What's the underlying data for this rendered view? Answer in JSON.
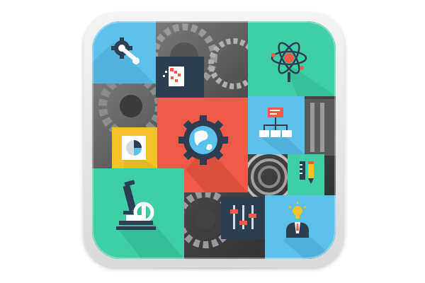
{
  "colors": {
    "sky_blue": "#5bc0ea",
    "teal": "#3ecfa6",
    "coral": "#ef5b48",
    "navy": "#2c3e50",
    "yellow": "#f5c22c",
    "frame": "#e6e6e6",
    "metal": "#6d6d6d"
  },
  "tiles": [
    {
      "name": "gear-wrench",
      "icon": "gear-wrench-icon"
    },
    {
      "name": "pixel-document",
      "icon": "pixel-document-icon"
    },
    {
      "name": "atom",
      "icon": "atom-icon"
    },
    {
      "name": "pie-chart",
      "icon": "pie-chart-icon"
    },
    {
      "name": "globe-gear",
      "icon": "globe-gear-icon"
    },
    {
      "name": "org-chart",
      "icon": "org-chart-icon"
    },
    {
      "name": "pencil-ruler",
      "icon": "pencil-ruler-icon"
    },
    {
      "name": "microscope",
      "icon": "microscope-icon"
    },
    {
      "name": "mixer-sliders",
      "icon": "mixer-sliders-icon"
    },
    {
      "name": "idea-businessman",
      "icon": "idea-businessman-icon"
    }
  ]
}
